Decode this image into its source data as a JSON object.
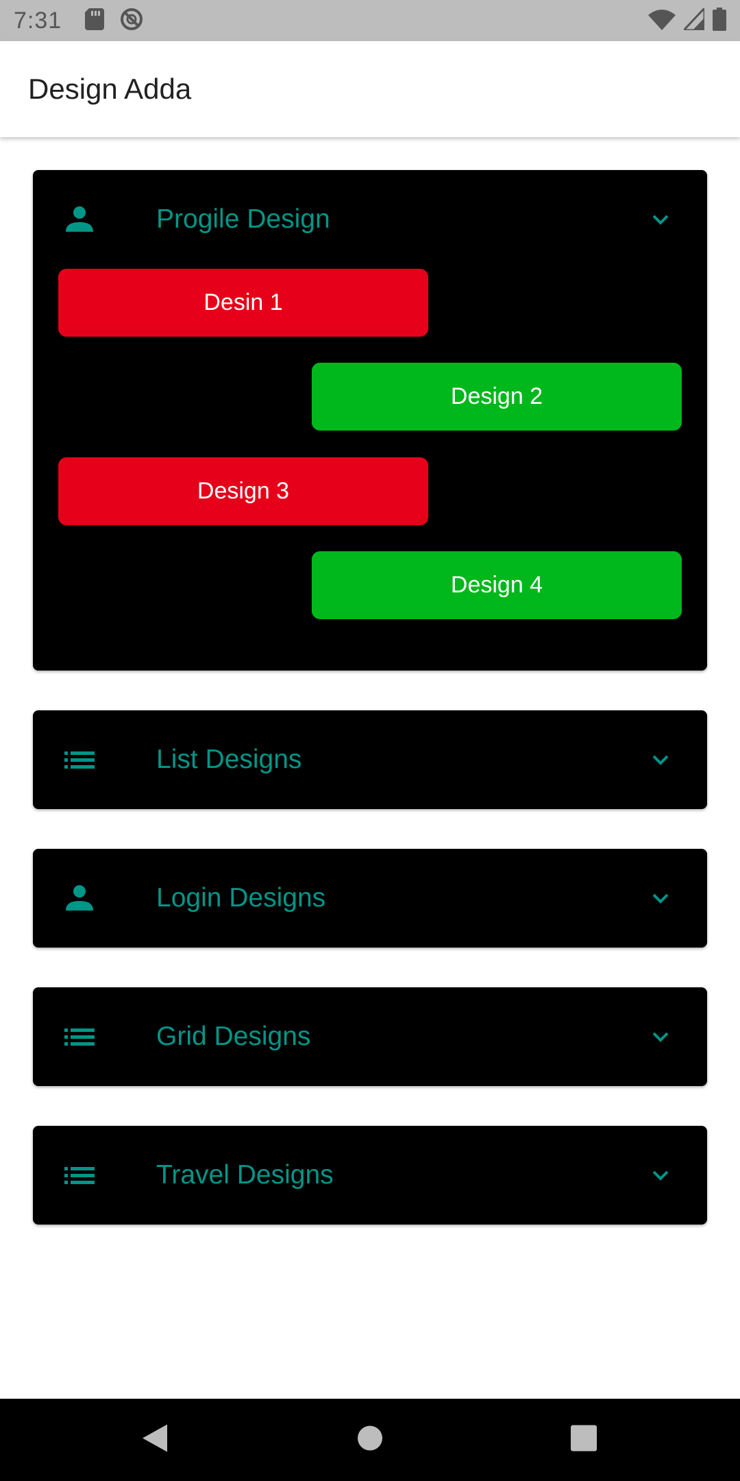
{
  "status_bar": {
    "time": "7:31",
    "left_icons": [
      "sd-card-icon",
      "data-saver-icon"
    ],
    "right_icons": [
      "wifi-icon",
      "cell-signal-icon",
      "battery-icon"
    ]
  },
  "app_bar": {
    "title": "Design Adda"
  },
  "colors": {
    "accent": "#009688",
    "panel_bg": "#000000",
    "red_button": "#e60019",
    "green_button": "#00b81c"
  },
  "panels": [
    {
      "title": "Progile Design",
      "icon": "person-icon",
      "expanded": true,
      "buttons": [
        {
          "label": "Desin 1",
          "color": "red"
        },
        {
          "label": "Design 2",
          "color": "green"
        },
        {
          "label": "Design 3",
          "color": "red"
        },
        {
          "label": "Design 4",
          "color": "green"
        }
      ]
    },
    {
      "title": "List Designs",
      "icon": "list-icon",
      "expanded": false
    },
    {
      "title": "Login Designs",
      "icon": "person-icon",
      "expanded": false
    },
    {
      "title": "Grid Designs",
      "icon": "list-icon",
      "expanded": false
    },
    {
      "title": "Travel Designs",
      "icon": "list-icon",
      "expanded": false
    }
  ],
  "nav_bar": {
    "buttons": [
      "back-icon",
      "home-icon",
      "recents-icon"
    ]
  }
}
